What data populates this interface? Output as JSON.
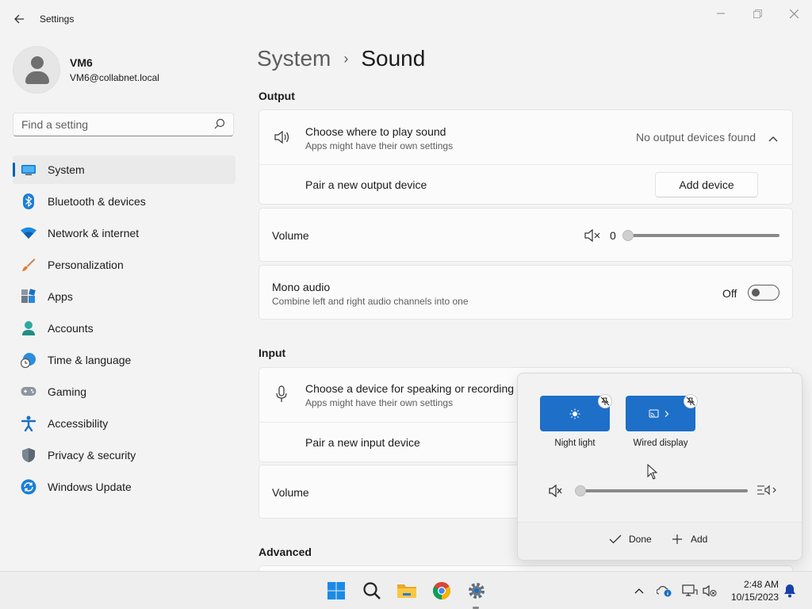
{
  "window": {
    "title": "Settings",
    "back_label": "Back",
    "minimize_label": "Minimize",
    "maximize_label": "Maximize",
    "close_label": "Close"
  },
  "profile": {
    "name": "VM6",
    "email": "VM6@collabnet.local"
  },
  "search": {
    "placeholder": "Find a setting",
    "value": ""
  },
  "sidebar": {
    "items": [
      {
        "label": "System",
        "icon": "monitor-icon",
        "active": true
      },
      {
        "label": "Bluetooth & devices",
        "icon": "bluetooth-icon"
      },
      {
        "label": "Network & internet",
        "icon": "wifi-icon"
      },
      {
        "label": "Personalization",
        "icon": "paintbrush-icon"
      },
      {
        "label": "Apps",
        "icon": "apps-icon"
      },
      {
        "label": "Accounts",
        "icon": "person-icon"
      },
      {
        "label": "Time & language",
        "icon": "clock-globe-icon"
      },
      {
        "label": "Gaming",
        "icon": "gamepad-icon"
      },
      {
        "label": "Accessibility",
        "icon": "accessibility-icon"
      },
      {
        "label": "Privacy & security",
        "icon": "shield-icon"
      },
      {
        "label": "Windows Update",
        "icon": "windows-update-icon"
      }
    ]
  },
  "breadcrumb": {
    "parent": "System",
    "separator": "›",
    "current": "Sound"
  },
  "output": {
    "section_title": "Output",
    "choose_title": "Choose where to play sound",
    "choose_sub": "Apps might have their own settings",
    "status": "No output devices found",
    "pair_label": "Pair a new output device",
    "add_device_label": "Add device",
    "volume_label": "Volume",
    "volume_value": "0",
    "volume_level": 0,
    "mono_title": "Mono audio",
    "mono_sub": "Combine left and right audio channels into one",
    "mono_state": "Off"
  },
  "input": {
    "section_title": "Input",
    "choose_title": "Choose a device for speaking or recording",
    "choose_sub": "Apps might have their own settings",
    "pair_label": "Pair a new input device",
    "volume_label": "Volume"
  },
  "advanced": {
    "section_title": "Advanced"
  },
  "quick_settings": {
    "tiles": [
      {
        "label": "Night light",
        "icon": "night-light-icon"
      },
      {
        "label": "Wired display",
        "icon": "cast-icon"
      }
    ],
    "volume_level": 0,
    "done_label": "Done",
    "add_label": "Add"
  },
  "taskbar": {
    "time": "2:48 AM",
    "date": "10/15/2023"
  },
  "colors": {
    "accent": "#005fb8",
    "tile": "#1e6fc8",
    "background": "#f3f3f3",
    "card": "#fbfbfb"
  }
}
